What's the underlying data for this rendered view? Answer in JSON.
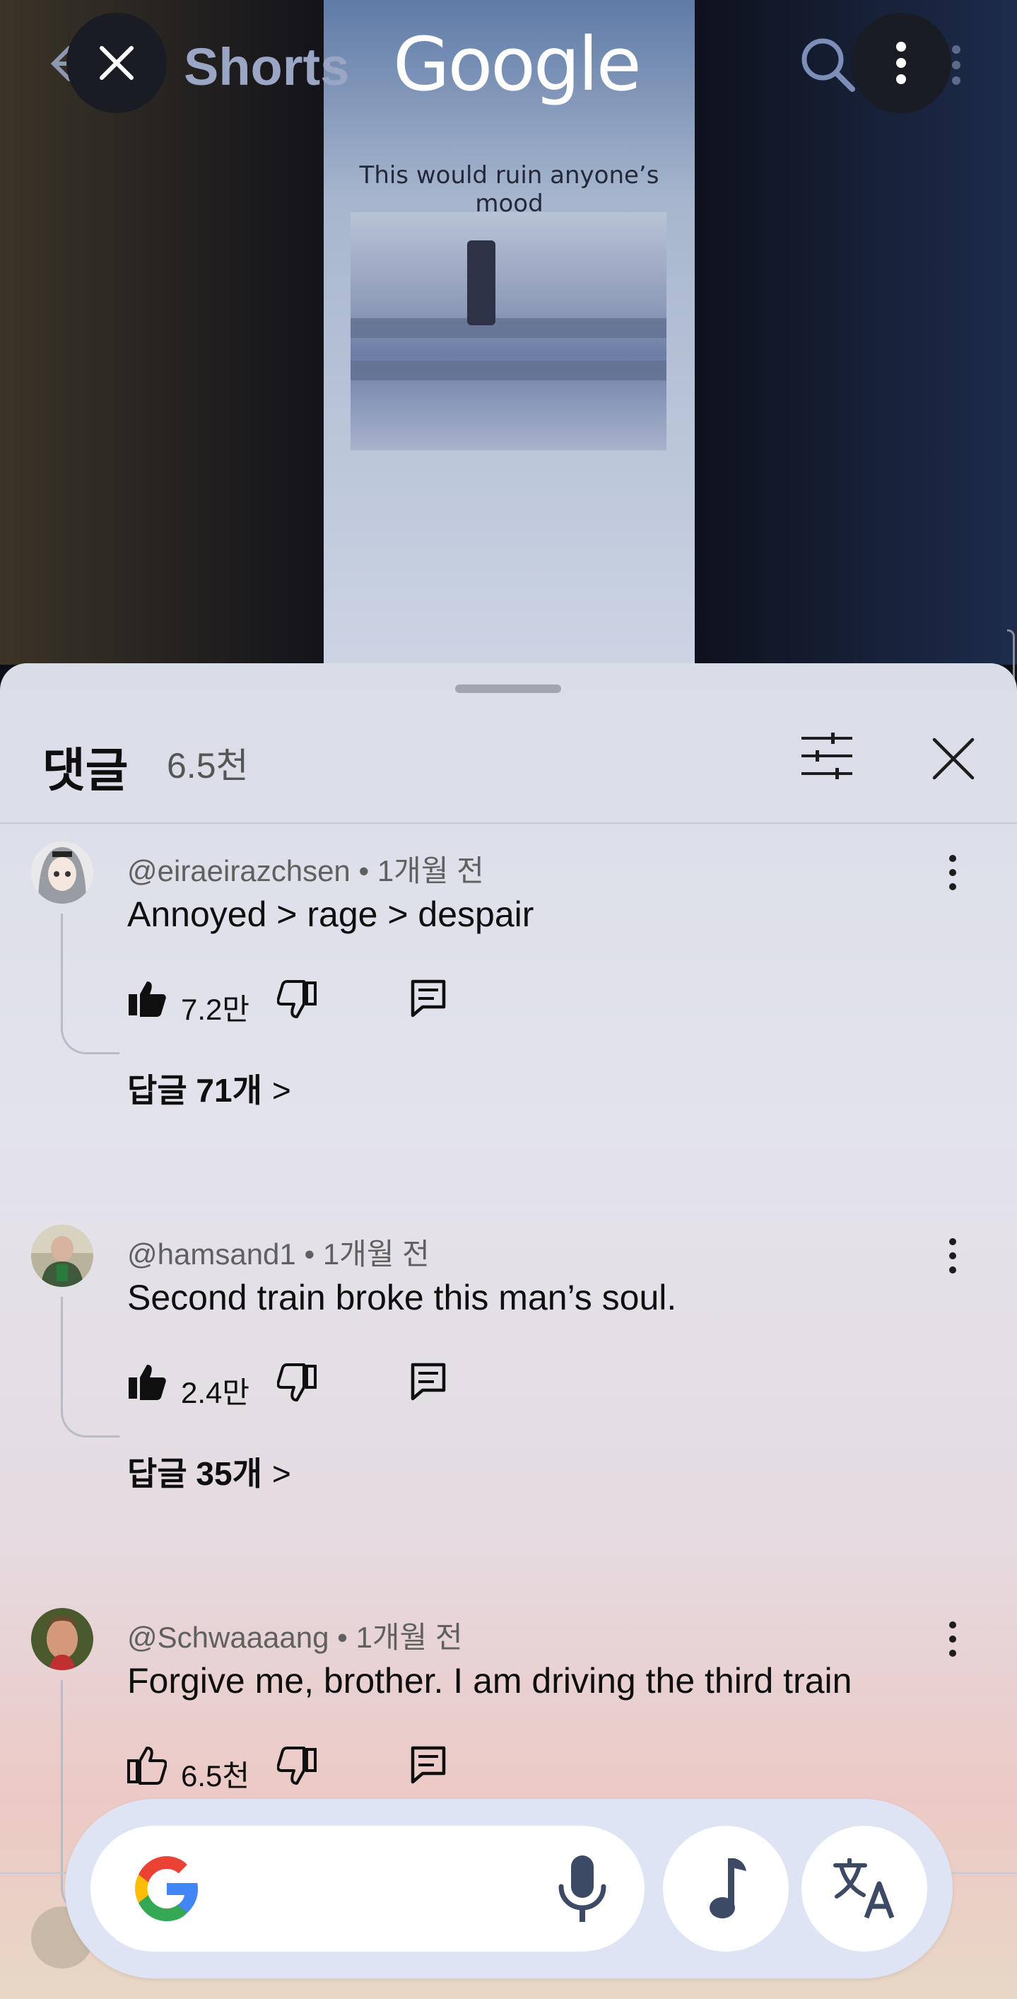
{
  "top": {
    "shorts_title": "Shorts",
    "google_logo": "Google",
    "video_caption": "This would ruin anyone’s mood"
  },
  "comments_panel": {
    "title": "댓글",
    "count": "6.5천",
    "comments": [
      {
        "author": "@eiraeirazchsen",
        "time": "1개월 전",
        "text": "Annoyed > rage > despair",
        "likes": "7.2만",
        "replies": "답글 71개"
      },
      {
        "author": "@hamsand1",
        "time": "1개월 전",
        "text": "Second train broke this man’s soul.",
        "likes": "2.4만",
        "replies": "답글 35개"
      },
      {
        "author": "@Schwaaaang",
        "time": "1개월 전",
        "text": "Forgive me, brother. I am driving the third train",
        "likes": "6.5천"
      }
    ]
  },
  "icons": {
    "back": "arrow-left-icon",
    "close_video": "close-icon",
    "search": "search-icon",
    "more": "more-vert-icon",
    "filter": "filter-sliders-icon",
    "close_panel": "close-icon",
    "like": "thumb-up-icon",
    "dislike": "thumb-down-icon",
    "reply": "comment-icon",
    "google": "google-g-icon",
    "mic": "mic-icon",
    "music": "music-note-icon",
    "translate": "translate-icon"
  },
  "colors": {
    "sheet_top": "#d9dde8",
    "sheet_bottom": "#ecc9c5",
    "search_bar_bg": "#dfe4f4",
    "accent_icon": "#3d4a66"
  }
}
